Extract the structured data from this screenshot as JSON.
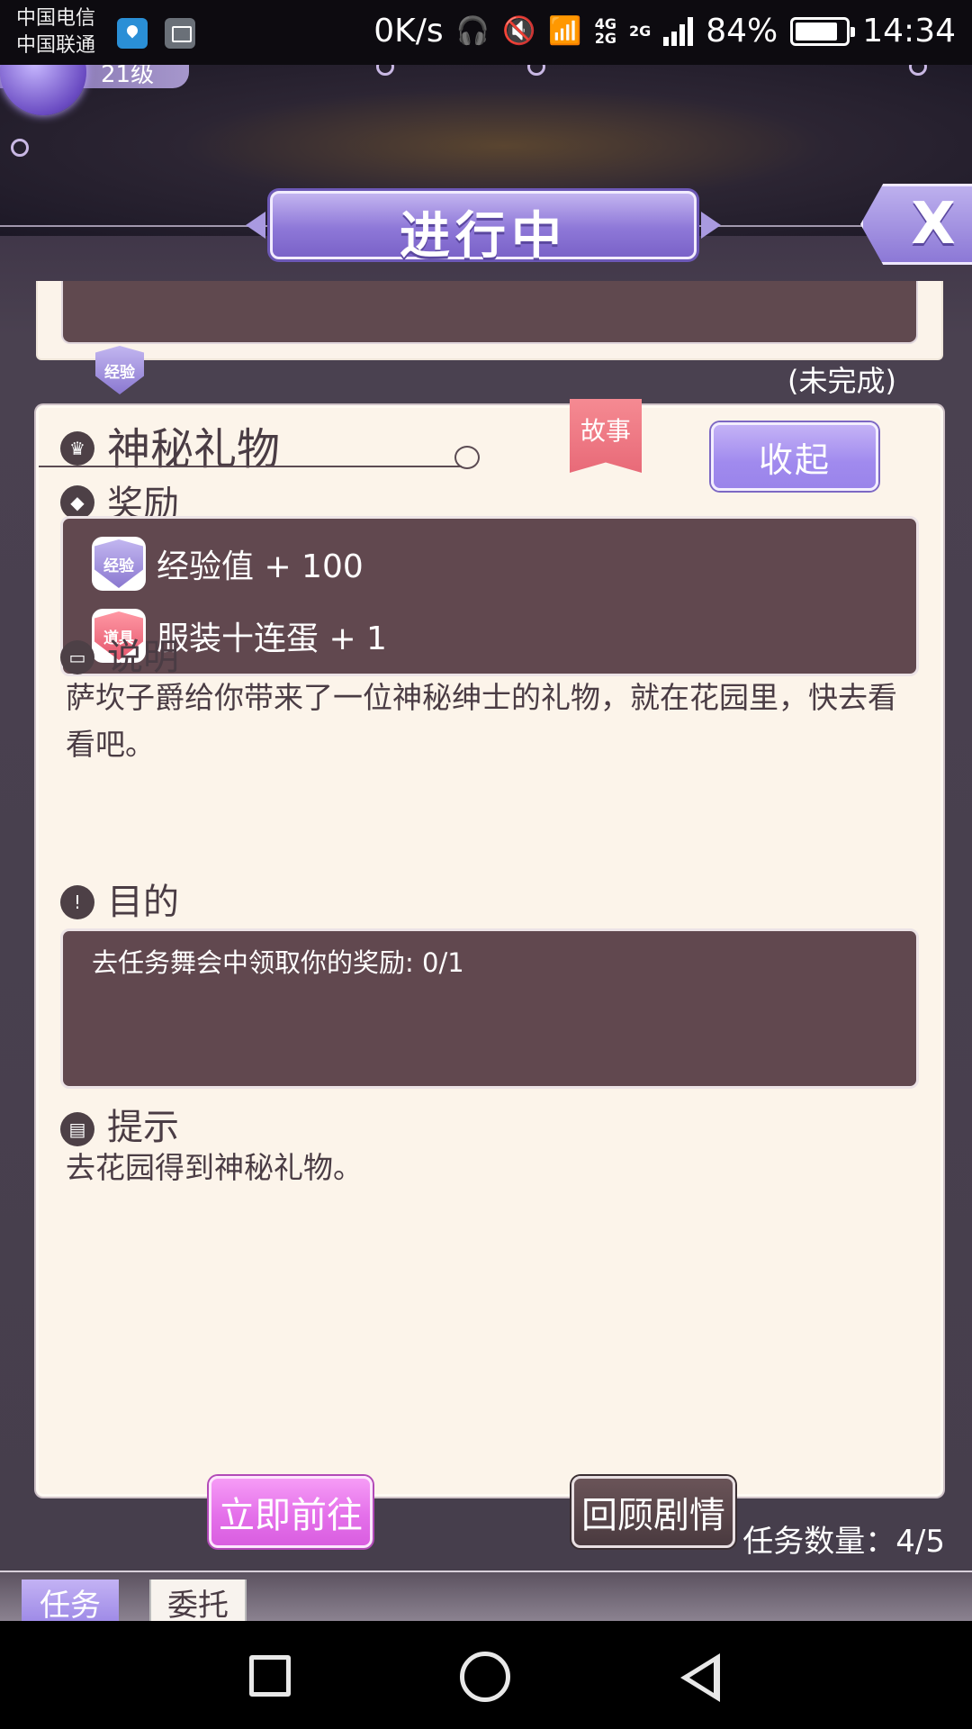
{
  "status_bar": {
    "carrier_1": "中国电信",
    "carrier_2": "中国联通",
    "speed": "0K/s",
    "network_1": "4G",
    "network_2": "2G",
    "network_3": "2G",
    "battery": "84%",
    "time": "14:34"
  },
  "player": {
    "level": "21级"
  },
  "header": {
    "title": "进行中",
    "close_label": "X"
  },
  "previous_task": {
    "status": "(未完成)",
    "badge": "经验"
  },
  "task": {
    "name": "神秘礼物",
    "tag": "故事",
    "collapse_label": "收起",
    "reward_heading": "奖励",
    "rewards": [
      {
        "badge": "经验",
        "text": "经验值 + 100",
        "color": "#9a88dc"
      },
      {
        "badge": "道具",
        "text": "服装十连蛋 + 1",
        "color": "#ec6b7e"
      }
    ],
    "desc_heading": "说明",
    "description": "萨坎子爵给你带来了一位神秘绅士的礼物，就在花园里，快去看看吧。",
    "goal_heading": "目的",
    "goal": "去任务舞会中领取你的奖励: 0/1",
    "hint_heading": "提示",
    "hint": "去花园得到神秘礼物。",
    "go_label": "立即前往",
    "review_label": "回顾剧情"
  },
  "task_count": "任务数量：4/5",
  "tabs": [
    {
      "label": "任务",
      "active": true
    },
    {
      "label": "委托",
      "active": false
    }
  ],
  "colors": {
    "accent": "#9a84ea",
    "card_bg": "#fcf4ea",
    "dark_box": "#61484f",
    "go_button": "#e470ea"
  }
}
